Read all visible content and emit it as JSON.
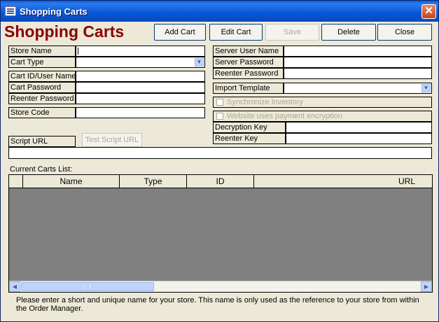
{
  "window": {
    "title": "Shopping Carts",
    "close_glyph": "✕",
    "icon": "access-form-icon"
  },
  "header": {
    "app_title": "Shopping Carts"
  },
  "toolbar": {
    "add_cart": "Add Cart",
    "edit_cart": "Edit Cart",
    "save": "Save",
    "delete": "Delete",
    "close": "Close"
  },
  "left_form": {
    "store_name": {
      "label": "Store Name",
      "value": ""
    },
    "cart_type": {
      "label": "Cart Type",
      "value": ""
    },
    "cart_id": {
      "label": "Cart ID/User Name",
      "value": ""
    },
    "cart_password": {
      "label": "Cart Password",
      "value": ""
    },
    "reenter_password": {
      "label": "Reenter Password",
      "value": ""
    },
    "store_code": {
      "label": "Store Code",
      "value": ""
    },
    "script_url": {
      "label": "Script URL",
      "value": ""
    },
    "test_script_url": "Test Script URL"
  },
  "right_form": {
    "server_user_name": {
      "label": "Server User Name",
      "value": ""
    },
    "server_password": {
      "label": "Server Password",
      "value": ""
    },
    "reenter_password": {
      "label": "Reenter Password",
      "value": ""
    },
    "import_template": {
      "label": "Import Template",
      "value": ""
    },
    "synchronize_inventory": {
      "label": "Synchronize Inventory",
      "checked": false
    },
    "website_encryption": {
      "label": "Website uses payment encryption",
      "checked": false
    },
    "decryption_key": {
      "label": "Decryption Key",
      "value": ""
    },
    "reenter_key": {
      "label": "Reenter Key",
      "value": ""
    }
  },
  "carts_list": {
    "caption": "Current Carts List:",
    "columns": [
      "Name",
      "Type",
      "ID",
      "URL"
    ],
    "rows": []
  },
  "help_text": "Please enter a short and unique name for your store. This name is only used as the reference to your store from within the Order Manager.",
  "colors": {
    "title_red": "#8b0000",
    "grid_bg": "#808080",
    "titlebar_blue": "#0a5fd8"
  }
}
